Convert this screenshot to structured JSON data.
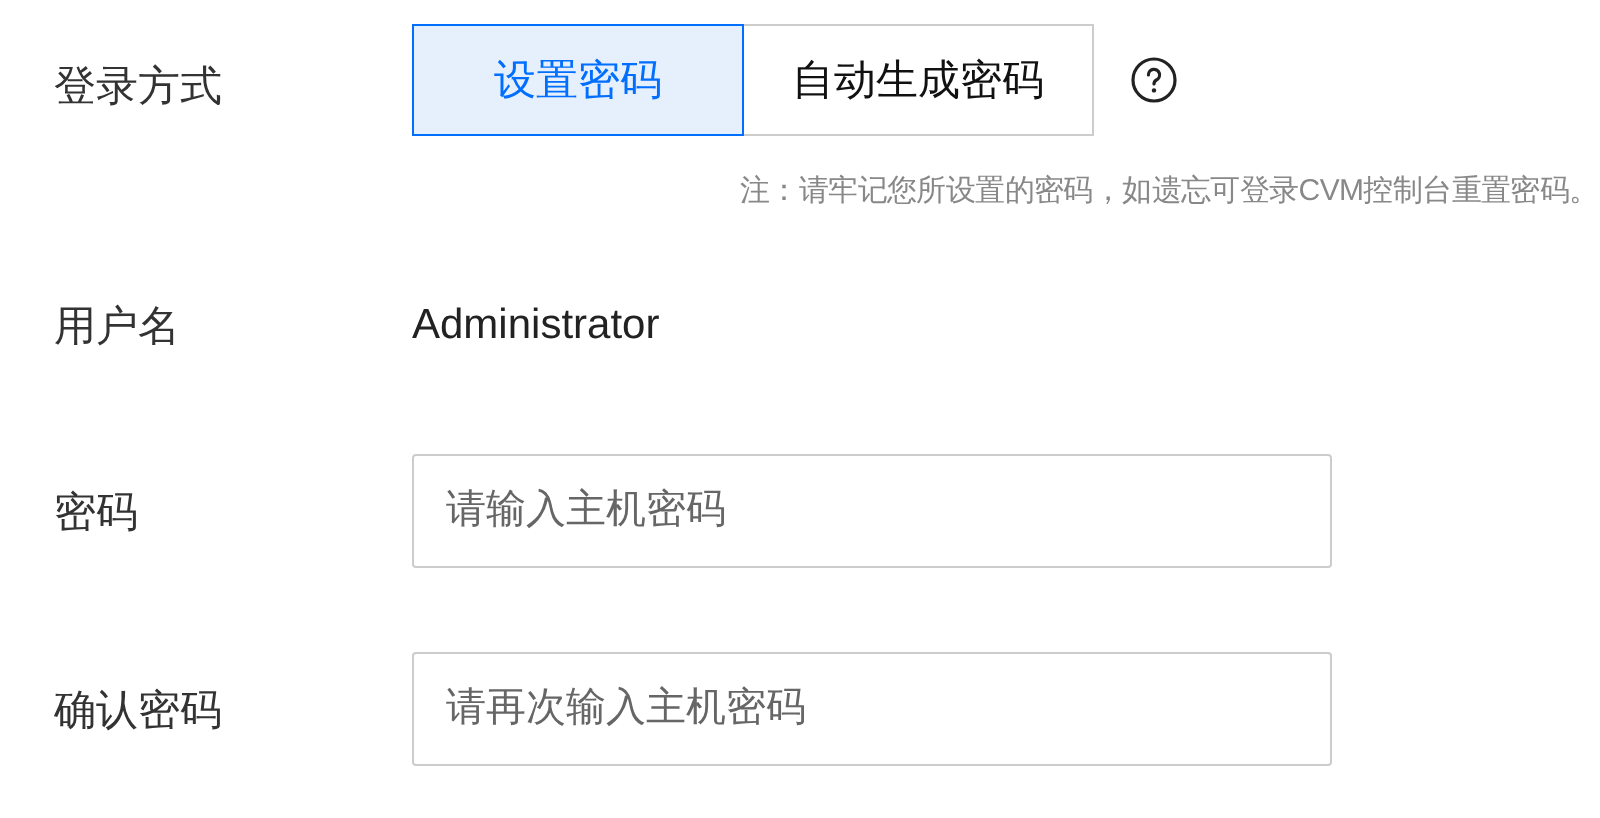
{
  "login_method": {
    "label": "登录方式",
    "options": [
      {
        "label": "设置密码",
        "selected": true
      },
      {
        "label": "自动生成密码",
        "selected": false
      }
    ],
    "note": "注：请牢记您所设置的密码，如遗忘可登录CVM控制台重置密码。"
  },
  "username": {
    "label": "用户名",
    "value": "Administrator"
  },
  "password": {
    "label": "密码",
    "placeholder": "请输入主机密码"
  },
  "confirm_password": {
    "label": "确认密码",
    "placeholder": "请再次输入主机密码"
  }
}
